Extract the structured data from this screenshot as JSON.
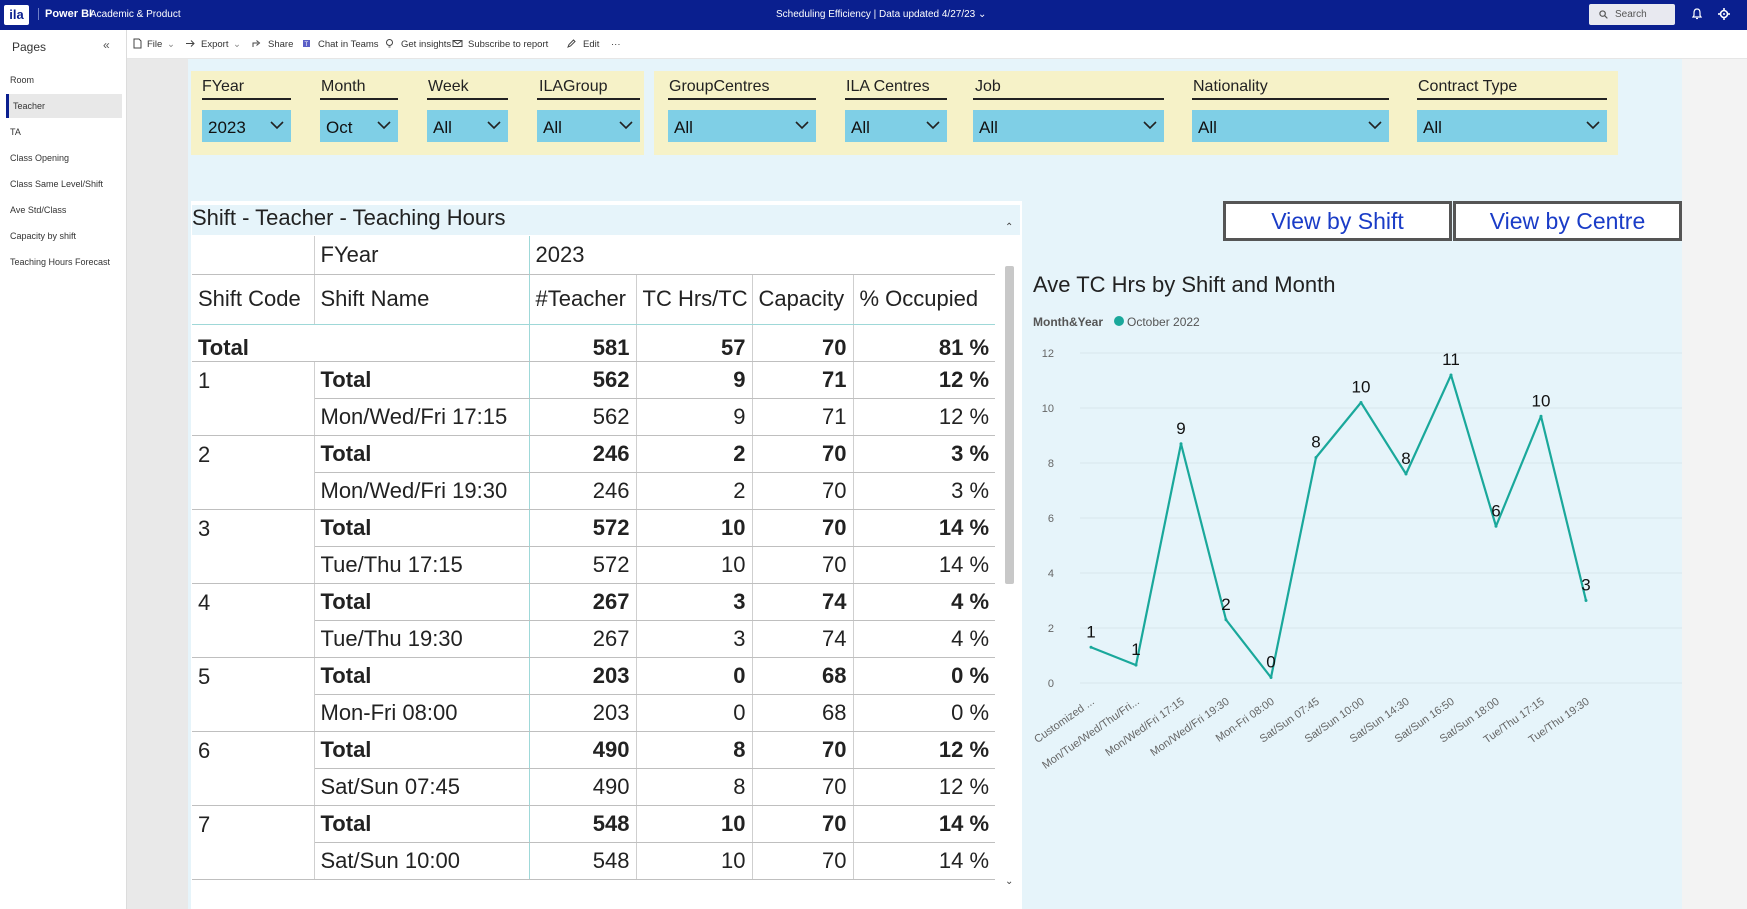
{
  "app": {
    "logo": "ila",
    "brand": "Power BI",
    "workspace": "Academic & Product",
    "report_title": "Scheduling Efficiency  |   Data updated 4/27/23  ⌄",
    "search_placeholder": "Search"
  },
  "sidebar": {
    "title": "Pages",
    "collapse_icon": "«",
    "items": [
      {
        "label": "Room"
      },
      {
        "label": "Teacher"
      },
      {
        "label": "TA"
      },
      {
        "label": "Class Opening"
      },
      {
        "label": "Class Same Level/Shift"
      },
      {
        "label": "Ave Std/Class"
      },
      {
        "label": "Capacity by shift"
      },
      {
        "label": "Teaching Hours Forecast"
      }
    ]
  },
  "toolbar": {
    "file": "File",
    "export": "Export",
    "share": "Share",
    "chat": "Chat in Teams",
    "insights": "Get insights",
    "subscribe": "Subscribe to report",
    "edit": "Edit",
    "more": "···"
  },
  "slicers": [
    {
      "label": "FYear",
      "value": "2023"
    },
    {
      "label": "Month",
      "value": "Oct"
    },
    {
      "label": "Week",
      "value": "All"
    },
    {
      "label": "ILAGroup",
      "value": "All"
    },
    {
      "label": "GroupCentres",
      "value": "All"
    },
    {
      "label": "ILA Centres",
      "value": "All"
    },
    {
      "label": "Job",
      "value": "All"
    },
    {
      "label": "Nationality",
      "value": "All"
    },
    {
      "label": "Contract Type",
      "value": "All"
    }
  ],
  "table": {
    "title": "Shift - Teacher - Teaching Hours",
    "fyear_label": "FYear",
    "fyear_value": "2023",
    "columns": [
      "Shift Code",
      "Shift Name",
      "#Teacher",
      "TC Hrs/TC",
      "Capacity",
      "% Occupied"
    ],
    "grand_total": {
      "label": "Total",
      "teacher": "581",
      "hrs": "57",
      "capacity": "70",
      "occupied": "81 %"
    },
    "groups": [
      {
        "code": "1",
        "total": [
          "Total",
          "562",
          "9",
          "71",
          "12 %"
        ],
        "detail": [
          "Mon/Wed/Fri 17:15",
          "562",
          "9",
          "71",
          "12 %"
        ]
      },
      {
        "code": "2",
        "total": [
          "Total",
          "246",
          "2",
          "70",
          "3 %"
        ],
        "detail": [
          "Mon/Wed/Fri 19:30",
          "246",
          "2",
          "70",
          "3 %"
        ]
      },
      {
        "code": "3",
        "total": [
          "Total",
          "572",
          "10",
          "70",
          "14 %"
        ],
        "detail": [
          "Tue/Thu 17:15",
          "572",
          "10",
          "70",
          "14 %"
        ]
      },
      {
        "code": "4",
        "total": [
          "Total",
          "267",
          "3",
          "74",
          "4 %"
        ],
        "detail": [
          "Tue/Thu 19:30",
          "267",
          "3",
          "74",
          "4 %"
        ]
      },
      {
        "code": "5",
        "total": [
          "Total",
          "203",
          "0",
          "68",
          "0 %"
        ],
        "detail": [
          "Mon-Fri 08:00",
          "203",
          "0",
          "68",
          "0 %"
        ]
      },
      {
        "code": "6",
        "total": [
          "Total",
          "490",
          "8",
          "70",
          "12 %"
        ],
        "detail": [
          "Sat/Sun 07:45",
          "490",
          "8",
          "70",
          "12 %"
        ]
      },
      {
        "code": "7",
        "total": [
          "Total",
          "548",
          "10",
          "70",
          "14 %"
        ],
        "detail": [
          "Sat/Sun 10:00",
          "548",
          "10",
          "70",
          "14 %"
        ]
      }
    ]
  },
  "buttons": {
    "by_shift": "View by Shift",
    "by_centre": "View by Centre"
  },
  "chart_data": {
    "type": "line",
    "title": "Ave TC Hrs by Shift and Month",
    "legend_title": "Month&Year",
    "legend_position": "top-left",
    "color": "#1aa89b",
    "series": [
      {
        "name": "October 2022",
        "values": [
          1.3,
          0.65,
          8.7,
          2.3,
          0.2,
          8.2,
          10.2,
          7.6,
          11.2,
          5.7,
          9.7,
          3.0
        ],
        "labels": [
          "1",
          "1",
          "9",
          "2",
          "0",
          "8",
          "10",
          "8",
          "11",
          "6",
          "10",
          "3"
        ]
      }
    ],
    "categories": [
      "Customized ...",
      "Mon/Tue/Wed/Thu/Fri...",
      "Mon/Wed/Fri 17:15",
      "Mon/Wed/Fri 19:30",
      "Mon-Fri 08:00",
      "Sat/Sun 07:45",
      "Sat/Sun 10:00",
      "Sat/Sun 14:30",
      "Sat/Sun 16:50",
      "Sat/Sun 18:00",
      "Tue/Thu 17:15",
      "Tue/Thu 19:30"
    ],
    "yticks": [
      "0",
      "2",
      "4",
      "6",
      "8",
      "10",
      "12"
    ],
    "ylim": [
      0,
      12
    ],
    "grid": true
  }
}
